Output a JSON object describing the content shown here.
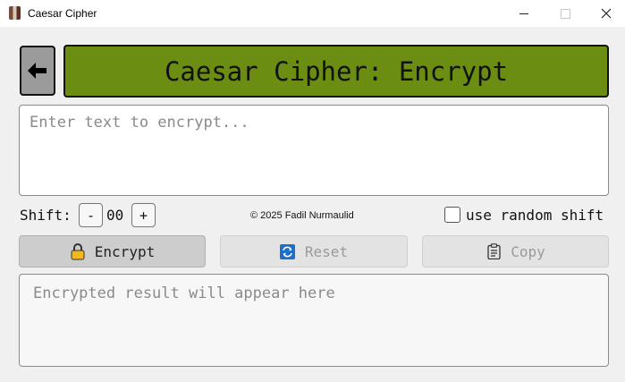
{
  "window": {
    "title": "Caesar Cipher",
    "icons": {
      "minimize": "minimize-icon",
      "maximize": "maximize-icon",
      "close": "close-icon"
    }
  },
  "header": {
    "back_icon": "arrow-left-icon",
    "title": "Caesar Cipher: Encrypt",
    "color": "#6b8e12"
  },
  "input": {
    "placeholder": "Enter text to encrypt...",
    "value": ""
  },
  "shift": {
    "label": "Shift:",
    "minus_label": "-",
    "value": "00",
    "plus_label": "+"
  },
  "footer_note": "© 2025 Fadil Nurmaulid",
  "random_shift": {
    "label": "use random shift",
    "checked": false
  },
  "actions": {
    "encrypt": {
      "label": "Encrypt",
      "icon": "lock-icon",
      "enabled": true
    },
    "reset": {
      "label": "Reset",
      "icon": "refresh-icon",
      "enabled": false
    },
    "copy": {
      "label": "Copy",
      "icon": "clipboard-icon",
      "enabled": false
    }
  },
  "output": {
    "placeholder": "Encrypted result will appear here"
  }
}
